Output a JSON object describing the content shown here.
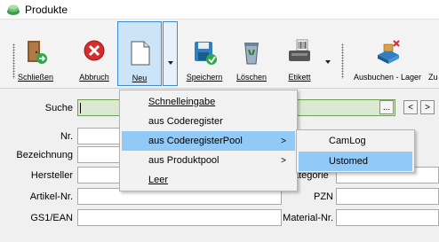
{
  "window": {
    "title": "Produkte"
  },
  "toolbar": {
    "close_label": "Schließen",
    "cancel_label": "Abbruch",
    "new_label": "Neu",
    "save_label": "Speichern",
    "delete_label": "Löschen",
    "label_label": "Etikett",
    "book_out_label": "Ausbuchen - Lager",
    "cut_label": "Zu"
  },
  "form": {
    "search_label": "Suche",
    "search_value": "",
    "more_button": "...",
    "prev_button": "<",
    "next_button": ">",
    "nr_label": "Nr.",
    "designation_label": "Bezeichnung",
    "manufacturer_label": "Hersteller",
    "article_no_label": "Artikel-Nr.",
    "gs1_ean_label": "GS1/EAN",
    "category_label": "ategorie",
    "pzn_label": "PZN",
    "material_no_label": "Material-Nr."
  },
  "menu": {
    "items": [
      {
        "label": "Schnelleingabe"
      },
      {
        "label": "aus Coderegister"
      },
      {
        "label": "aus CoderegisterPool",
        "arrow": ">"
      },
      {
        "label": "aus Produktpool",
        "arrow": ">"
      },
      {
        "label": "Leer"
      }
    ]
  },
  "submenu": {
    "items": [
      {
        "label": "CamLog"
      },
      {
        "label": "Ustomed"
      }
    ]
  },
  "colors": {
    "highlight": "#91c9f7",
    "search_bg": "#dbe9d1",
    "pressed_button": "#cce4f7"
  }
}
